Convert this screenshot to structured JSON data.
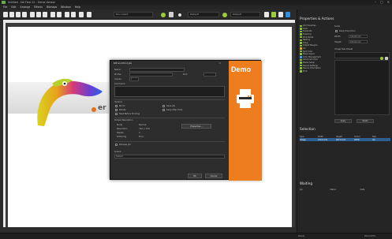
{
  "window": {
    "title": "Untitled - SAi Flexi 22 – Demo Version",
    "minimize": "–",
    "maximize": "□",
    "close": "✕"
  },
  "menu": [
    "File",
    "Edit",
    "Arrange",
    "Effects",
    "Bitmaps",
    "Window",
    "Help"
  ],
  "toolbar": {
    "dropdown1": "Document",
    "dropdown2": "Default",
    "dropdown3": "Default"
  },
  "brand": {
    "text": "er"
  },
  "right_panel": {
    "title": "Properties & Actions",
    "tree": [
      {
        "label": "Job Properties",
        "color": "g"
      },
      {
        "label": "Color",
        "color": "g"
      },
      {
        "label": "Duplicate",
        "color": "g"
      },
      {
        "label": "Finishing",
        "color": "g"
      },
      {
        "label": "Print Marks",
        "color": "g"
      },
      {
        "label": "Nesting",
        "color": "g"
      },
      {
        "label": "Tiling",
        "color": "g"
      },
      {
        "label": "Output Margins",
        "color": "g"
      },
      {
        "label": "Ink",
        "color": "y"
      },
      {
        "label": "Spot Color",
        "color": "g"
      },
      {
        "label": "Mask Layers",
        "color": "g"
      },
      {
        "label": "Color Management",
        "color": "b"
      },
      {
        "label": "Advanced Color",
        "color": "g"
      },
      {
        "label": "Media Setup",
        "color": "g"
      },
      {
        "label": "Device Settings",
        "color": "g"
      },
      {
        "label": "Device Information",
        "color": "g"
      },
      {
        "label": "Print",
        "color": "g"
      }
    ],
    "props": {
      "scale_label": "Scale",
      "keep_prop": "Keep Proportion",
      "width_label": "Width",
      "width_val": "100.00 mm",
      "height_label": "Height",
      "height_val": "100.00 mm",
      "image_label": "Image Size Preset",
      "apply": "Apply",
      "reset": "Reset"
    },
    "selection": {
      "title": "Selection",
      "headers": [
        "Type",
        "Width",
        "Height",
        "Colors",
        "Size"
      ],
      "row": [
        "Image",
        "210.0 mm",
        "297.0 mm",
        "CMYK",
        "Inh"
      ]
    },
    "waiting": {
      "title": "Waiting",
      "headers": [
        "Job",
        "Status",
        "Date"
      ]
    }
  },
  "status": {
    "left": "Ready",
    "right": "Zoom 63%"
  },
  "dialog": {
    "title": "RIP and Print Job",
    "close": "✕",
    "name_label": "Name:",
    "name_value": "",
    "printer_label": "Printer:",
    "printer_value": "",
    "port_label": "Port:",
    "port_value": "",
    "copies_label": "Copies:",
    "copies_value": "1",
    "comment_label": "Comment:",
    "options_label": "Options",
    "opt1": "Mirror",
    "opt2": "Rotate",
    "opt3": "Print Job Info",
    "opt4": "Save Job",
    "opt5": "Keep After Print",
    "opt6": "Nest Before Printing",
    "output_label": "Output Resolution",
    "mode_label": "Mode",
    "mode_value": "Normal",
    "res_label": "Resolution",
    "res_value": "720 × 720",
    "dpi_label": "DPI",
    "dpi_value": "720",
    "passes_label": "Passes",
    "passes_value": "4",
    "dither_label": "Dithering",
    "dither_value": "Error",
    "props_btn": "Properties...",
    "preview_label": "Preview Job",
    "queue_label": "Queue",
    "queue_value": "Default",
    "ok": "OK",
    "cancel": "Cancel",
    "demo": "Demo"
  }
}
